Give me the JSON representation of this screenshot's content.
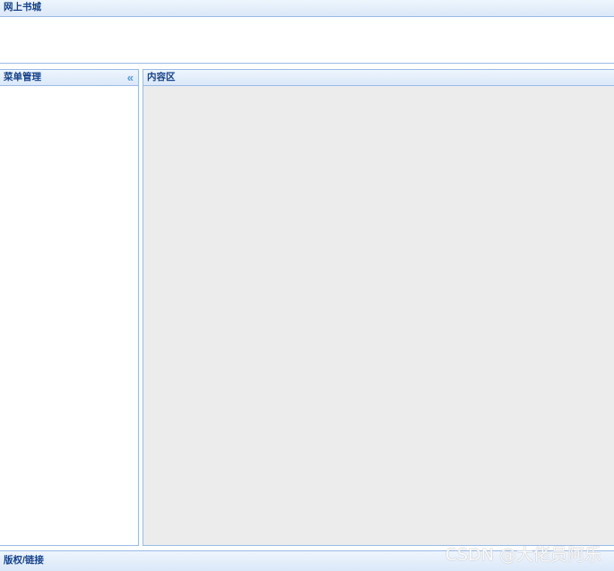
{
  "north": {
    "title": "网上书城"
  },
  "west": {
    "title": "菜单管理",
    "collapse_glyph": "«",
    "collapse_icon": "double-chevron-left-icon"
  },
  "center": {
    "title": "内容区"
  },
  "south": {
    "title": "版权/链接"
  },
  "watermark": {
    "text": "CSDN @大佬员阿乐"
  },
  "colors": {
    "header_border": "#99bbe8",
    "header_text": "#15428b",
    "center_bg": "#ececec",
    "collapse_icon": "#4b9de0"
  }
}
